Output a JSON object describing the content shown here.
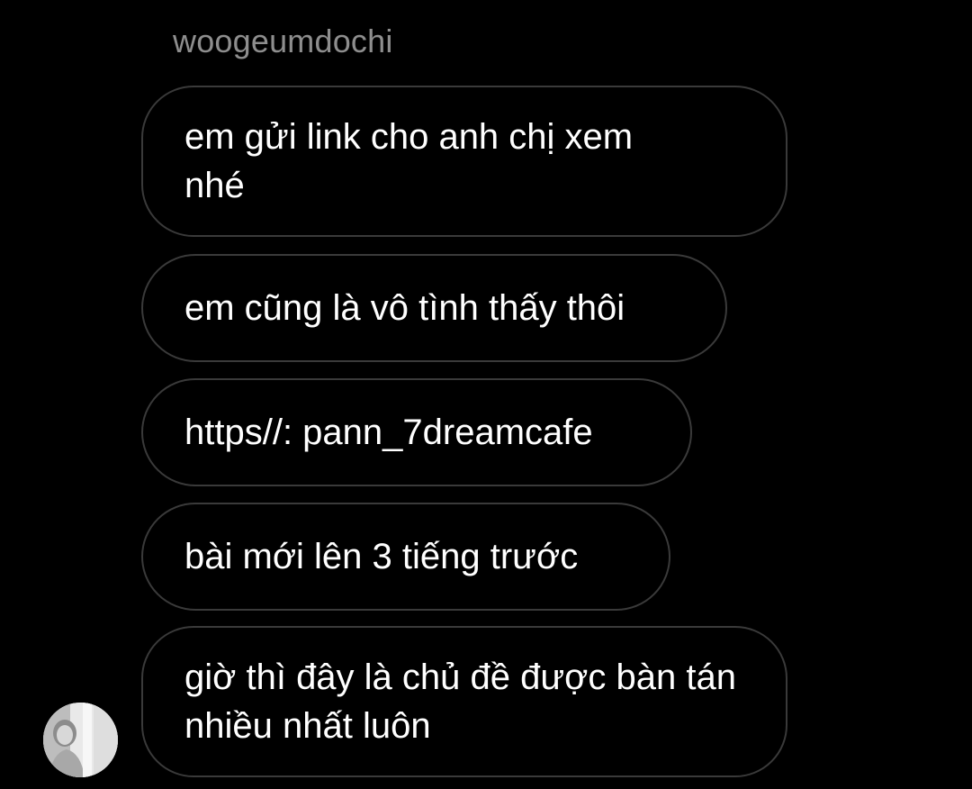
{
  "thread": {
    "sender_name": "woogeumdochi",
    "messages": [
      {
        "text": "em gửi link cho anh chị xem nhé"
      },
      {
        "text": "em cũng là vô tình thấy thôi"
      },
      {
        "text": "https//: pann_7dreamcafe"
      },
      {
        "text": "bài mới lên 3 tiếng trước"
      },
      {
        "text": "giờ thì đây là chủ đề được bàn tán nhiều nhất luôn"
      }
    ]
  },
  "colors": {
    "background": "#000000",
    "bubble_border": "#3a3a3a",
    "message_text": "#ffffff",
    "sender_name": "#8e8e8e"
  },
  "icons": {
    "avatar": "sender-profile-photo"
  }
}
